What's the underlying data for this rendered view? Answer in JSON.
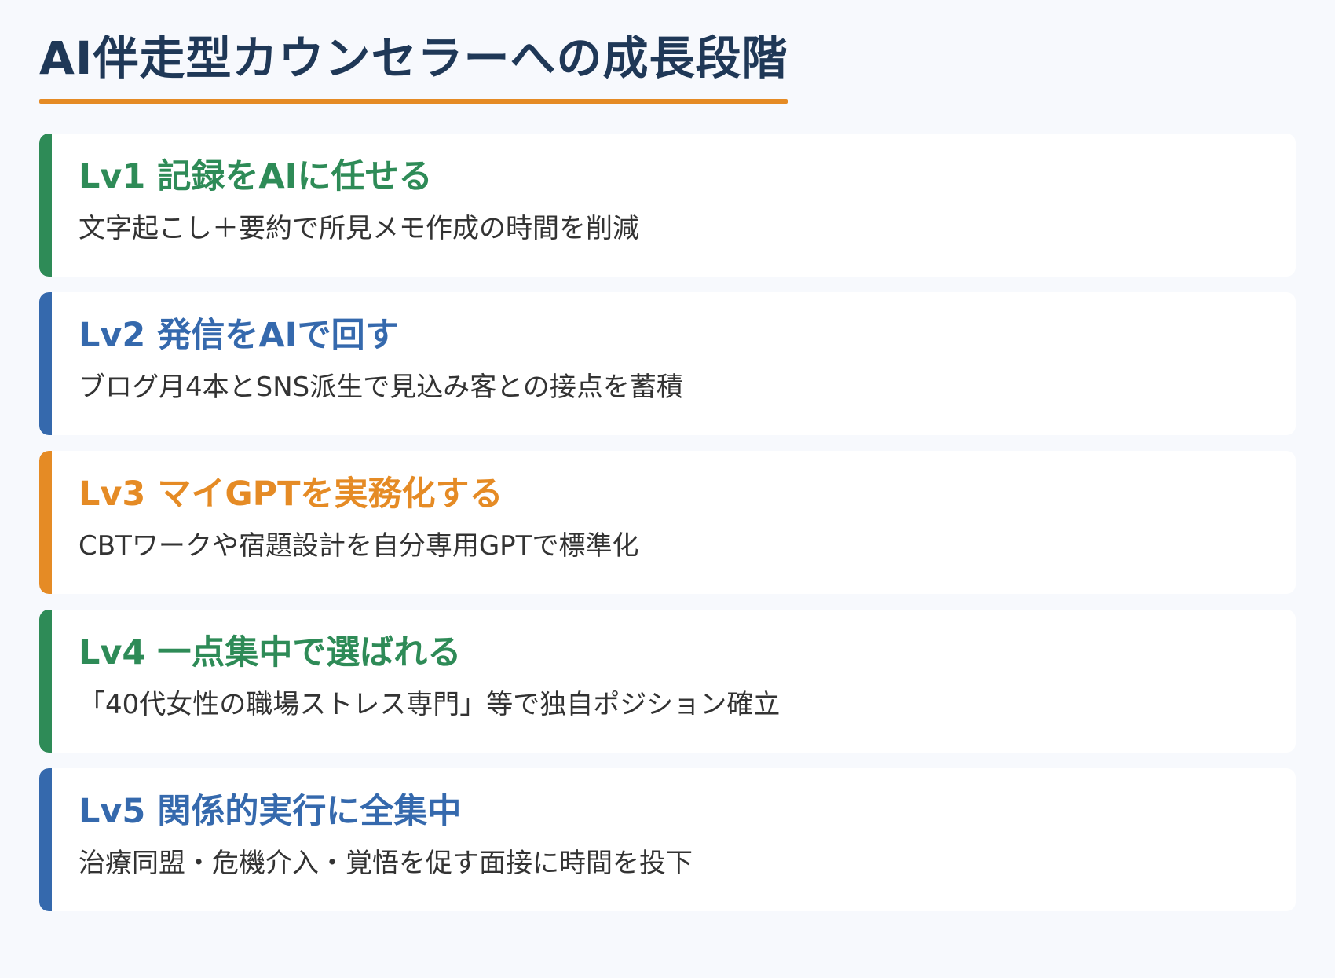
{
  "title": "AI伴走型カウンセラーへの成長段階",
  "colors": {
    "title": "#1f3857",
    "underline": "#e58b25",
    "green": "#2e8b57",
    "blue": "#3569ad",
    "orange": "#e58b25",
    "background": "#f7f9fd",
    "card": "#ffffff",
    "text": "#333333"
  },
  "levels": [
    {
      "title": "Lv1 記録をAIに任せる",
      "description": "文字起こし＋要約で所見メモ作成の時間を削減",
      "accent": "#2e8b57"
    },
    {
      "title": "Lv2 発信をAIで回す",
      "description": "ブログ月4本とSNS派生で見込み客との接点を蓄積",
      "accent": "#3569ad"
    },
    {
      "title": "Lv3 マイGPTを実務化する",
      "description": "CBTワークや宿題設計を自分専用GPTで標準化",
      "accent": "#e58b25"
    },
    {
      "title": "Lv4 一点集中で選ばれる",
      "description": "「40代女性の職場ストレス専門」等で独自ポジション確立",
      "accent": "#2e8b57"
    },
    {
      "title": "Lv5 関係的実行に全集中",
      "description": "治療同盟・危機介入・覚悟を促す面接に時間を投下",
      "accent": "#3569ad"
    }
  ]
}
